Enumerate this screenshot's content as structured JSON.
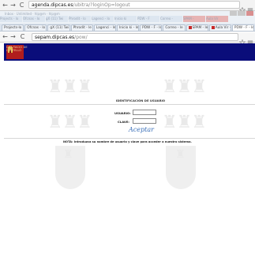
{
  "outer_browser": {
    "back_symbol": "←",
    "forward_symbol": "→",
    "reload_symbol": "C",
    "url_host": "agenda.dipcas.es",
    "url_path": "/ubitra/?loginOp=logout"
  },
  "faded_band": {
    "top_text": "Inbox · Unlimited · hlp@m · hlp@m",
    "tabs": [
      "Projects - lo",
      "Ofcnas - lo",
      "gX (11) Twi",
      "Phrodit - lo",
      "Lagenci - lo",
      "Inicio ki",
      "PDW - F",
      "Correo -",
      "SPAM -",
      "Aula Vir"
    ]
  },
  "tab_strip": {
    "tabs": [
      "Projects-lo",
      "Ofcnas - lo",
      "gX (11) Twi",
      "Phrodit - le",
      "Lagenci - le",
      "Inicio ki - le",
      "PDW - F - le",
      "Correo - le",
      "SPAM - le",
      "Aula Vir - le",
      "PDW - F - le"
    ]
  },
  "inner_browser": {
    "url_host": "sepam.dipcas.es",
    "url_path": "/pow/"
  },
  "site": {
    "logo_text": "DIPUTACIÓ DE CASTELLÓ"
  },
  "login": {
    "title": "IDENTIFICACIÓN DE USUARIO",
    "user_label": "USUARIO:",
    "password_label": "CLAVE:",
    "submit_label": "Aceptar",
    "note": "NOTA: Introduzca su nombre de usuario y clave para acceder a nuestro sistema."
  },
  "colors": {
    "header_blue": "#0a0d7a",
    "logo_red": "#b01d1d",
    "link_blue": "#3a6fb8"
  }
}
